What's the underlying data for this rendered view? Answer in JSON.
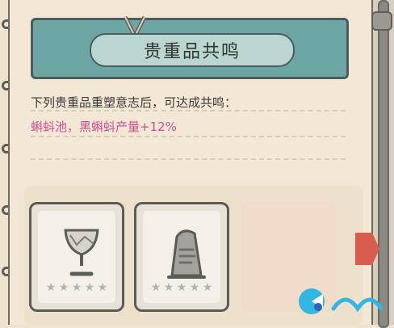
{
  "header": {
    "title": "贵重品共鸣"
  },
  "description": {
    "line1": "下列贵重品重塑意志后，可达成共鸣：",
    "line2": "蝌蚪池，黑蝌蚪产量+12%"
  },
  "items": [
    {
      "name": "chalice",
      "stars": 5,
      "icon": "chalice-icon"
    },
    {
      "name": "stone-tablet",
      "stars": 5,
      "icon": "stone-tablet-icon"
    },
    {
      "name": "empty-slot",
      "stars": 0,
      "icon": ""
    }
  ],
  "colors": {
    "accent_teal": "#6ca7a6",
    "bonus_pink": "#c9508e",
    "arrow_red": "#d85d4f"
  }
}
